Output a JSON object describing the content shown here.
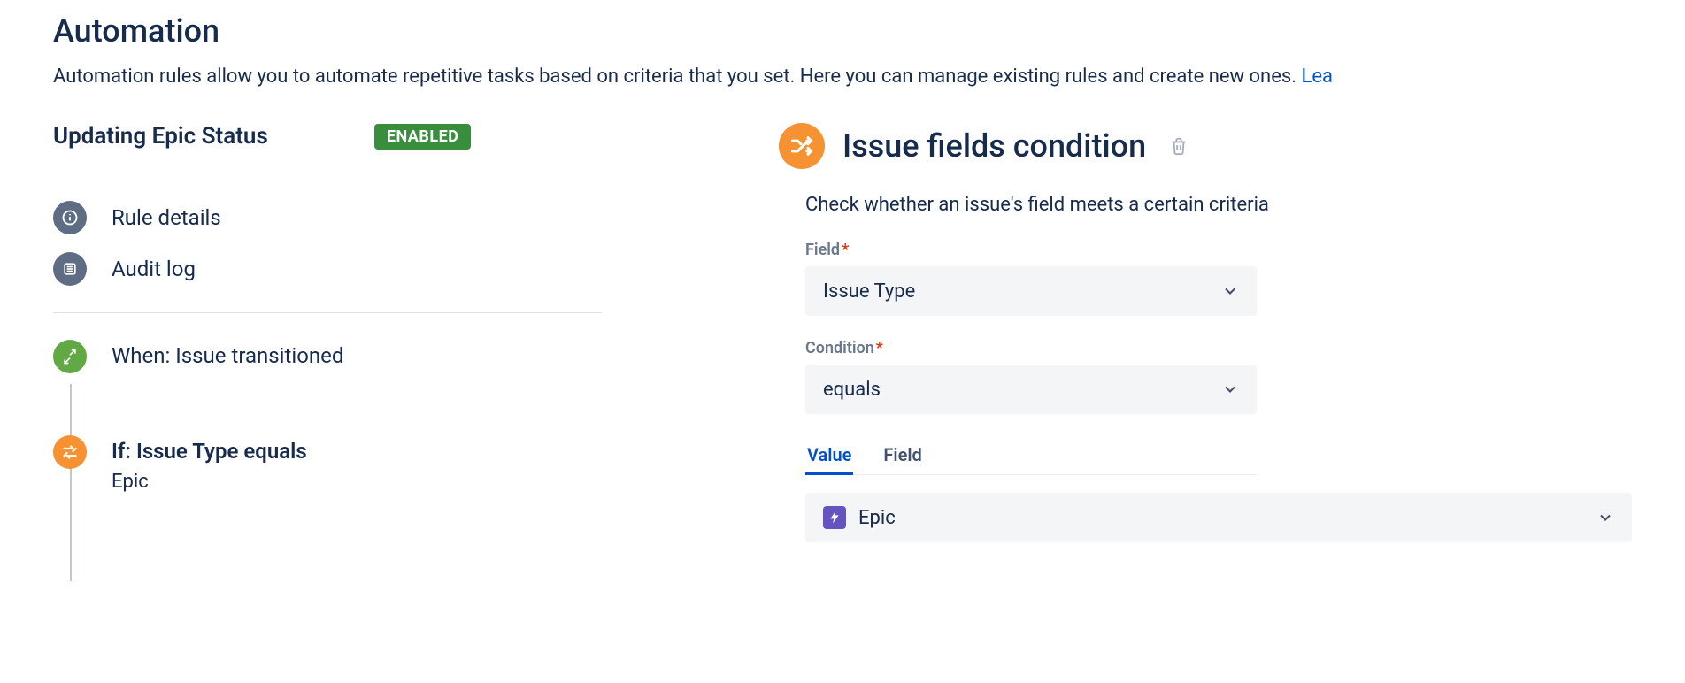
{
  "page": {
    "title": "Automation",
    "description_prefix": "Automation rules allow you to automate repetitive tasks based on criteria that you set. Here you can manage existing rules and create new ones. ",
    "learn_link": "Lea"
  },
  "rule": {
    "name": "Updating Epic Status",
    "status_badge": "ENABLED"
  },
  "nav": {
    "rule_details": "Rule details",
    "audit_log": "Audit log"
  },
  "timeline": {
    "trigger": {
      "label": "When: Issue transitioned"
    },
    "condition": {
      "label": "If: Issue Type equals",
      "detail": "Epic"
    }
  },
  "panel": {
    "title": "Issue fields condition",
    "description": "Check whether an issue's field meets a certain criteria",
    "field_label": "Field",
    "field_value": "Issue Type",
    "condition_label": "Condition",
    "condition_value": "equals",
    "tabs": {
      "value": "Value",
      "field": "Field"
    },
    "value_selected": "Epic"
  }
}
